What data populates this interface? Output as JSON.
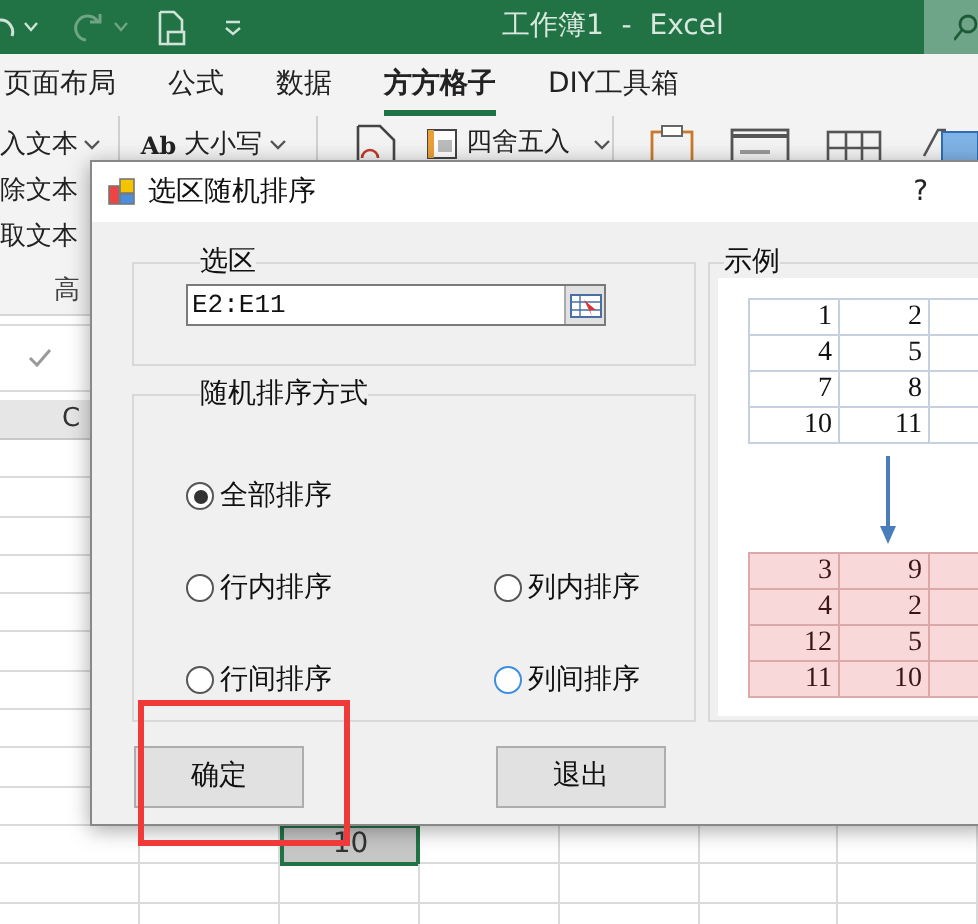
{
  "title_bar": {
    "title": "工作簿1  -  Excel"
  },
  "ribbon_tabs": [
    {
      "label": "页面布局",
      "selected": false
    },
    {
      "label": "公式",
      "selected": false
    },
    {
      "label": "数据",
      "selected": false
    },
    {
      "label": "方方格子",
      "selected": true
    },
    {
      "label": "DIY工具箱",
      "selected": false
    }
  ],
  "ribbon": {
    "text_commands": [
      "入文本",
      "除文本",
      "取文本"
    ],
    "group_label": "高",
    "case_command": {
      "prefix": "Ab",
      "label": "大小写"
    },
    "round_command": "四舍五入"
  },
  "sheet": {
    "column_header": "C",
    "selected_cell": "10"
  },
  "dialog": {
    "title": "选区随机排序",
    "help": "?",
    "range_group": {
      "label": "选区",
      "value": "E2:E11"
    },
    "mode_group": {
      "label": "随机排序方式",
      "options": [
        {
          "label": "全部排序",
          "selected": true,
          "color": "#555555"
        },
        {
          "label": "行内排序",
          "selected": false,
          "color": "#555555"
        },
        {
          "label": "列内排序",
          "selected": false,
          "color": "#555555"
        },
        {
          "label": "行间排序",
          "selected": false,
          "color": "#555555"
        },
        {
          "label": "列间排序",
          "selected": false,
          "color": "#3c8ee0"
        }
      ]
    },
    "example": {
      "label": "示例",
      "before": [
        [
          "1",
          "2"
        ],
        [
          "4",
          "5"
        ],
        [
          "7",
          "8"
        ],
        [
          "10",
          "11"
        ]
      ],
      "after": [
        [
          "3",
          "9"
        ],
        [
          "4",
          "2"
        ],
        [
          "12",
          "5"
        ],
        [
          "11",
          "10"
        ]
      ]
    },
    "buttons": [
      "确定",
      "退出"
    ]
  }
}
